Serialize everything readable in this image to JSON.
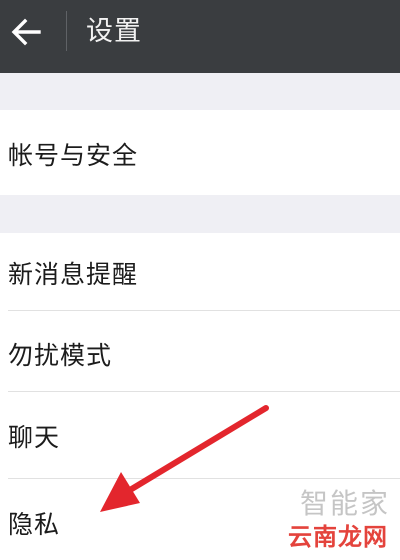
{
  "header": {
    "back_icon": "arrow-left-icon",
    "title": "设置",
    "background": "#3a3d40"
  },
  "settings": {
    "items": [
      {
        "label": "帐号与安全"
      },
      {
        "label": "新消息提醒"
      },
      {
        "label": "勿扰模式"
      },
      {
        "label": "聊天"
      },
      {
        "label": "隐私"
      }
    ]
  },
  "annotation": {
    "arrow_icon": "red-arrow-icon",
    "color": "#e3262d"
  },
  "watermark": {
    "top_text": "智能家",
    "bottom_text": "云南龙网",
    "bottom_color": "#e4433c"
  }
}
